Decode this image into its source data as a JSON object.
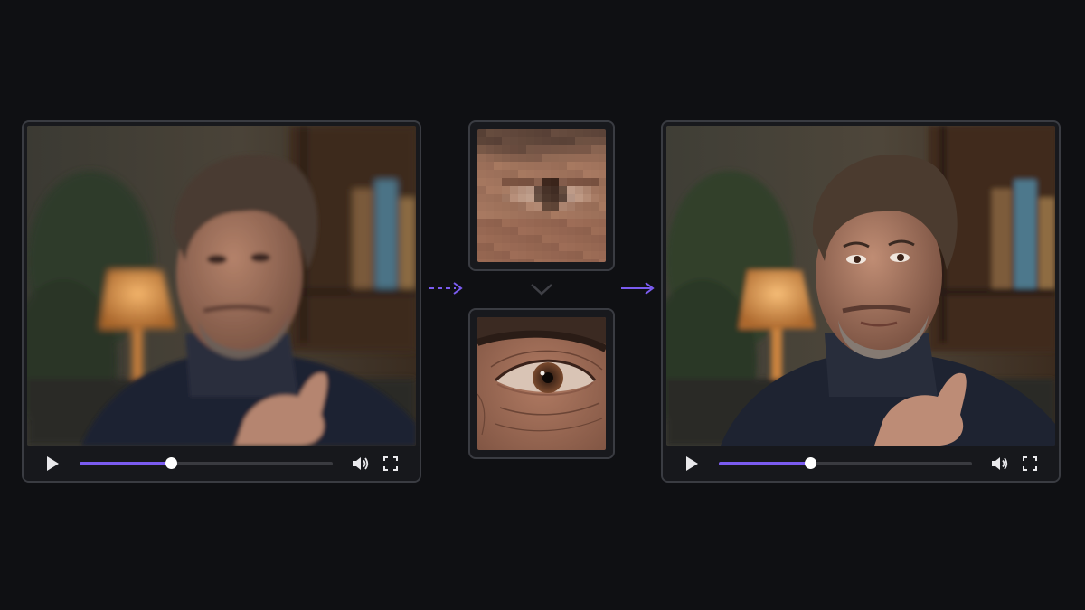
{
  "left_player": {
    "progress": 0.36,
    "icons": {
      "play": "play-icon",
      "volume": "volume-icon",
      "fullscreen": "fullscreen-icon"
    }
  },
  "right_player": {
    "progress": 0.36,
    "icons": {
      "play": "play-icon",
      "volume": "volume-icon",
      "fullscreen": "fullscreen-icon"
    }
  },
  "comparison": {
    "before_crop": "pixelated-eye-closeup",
    "after_crop": "sharp-eye-closeup",
    "connector_icons": [
      "dashed-arrow-right-icon",
      "chevron-down-icon",
      "arrow-right-icon"
    ]
  },
  "colors": {
    "accent": "#7b5cf0",
    "background": "#0f1013",
    "panel_border": "#3a3c42",
    "control_bar": "#17181c"
  }
}
